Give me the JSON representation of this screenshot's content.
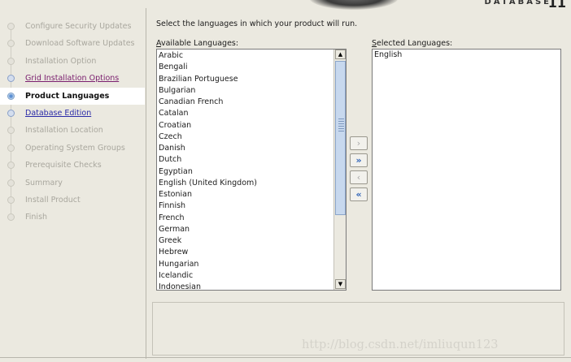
{
  "header": {
    "logo_text": "DATABASE",
    "logo_mark": "11"
  },
  "sidebar": {
    "steps": [
      {
        "label": "Configure Security Updates",
        "state": "disabled"
      },
      {
        "label": "Download Software Updates",
        "state": "disabled"
      },
      {
        "label": "Installation Option",
        "state": "disabled"
      },
      {
        "label": "Grid Installation Options",
        "state": "visited"
      },
      {
        "label": "Product Languages",
        "state": "current"
      },
      {
        "label": "Database Edition",
        "state": "link"
      },
      {
        "label": "Installation Location",
        "state": "disabled"
      },
      {
        "label": "Operating System Groups",
        "state": "disabled"
      },
      {
        "label": "Prerequisite Checks",
        "state": "disabled"
      },
      {
        "label": "Summary",
        "state": "disabled"
      },
      {
        "label": "Install Product",
        "state": "disabled"
      },
      {
        "label": "Finish",
        "state": "disabled"
      }
    ]
  },
  "main": {
    "instruction": "Select the languages in which your product will run.",
    "available_label_mnemonic": "A",
    "available_label_rest": "vailable Languages:",
    "selected_label_mnemonic": "S",
    "selected_label_rest": "elected Languages:",
    "available_languages": [
      "Arabic",
      "Bengali",
      "Brazilian Portuguese",
      "Bulgarian",
      "Canadian French",
      "Catalan",
      "Croatian",
      "Czech",
      "Danish",
      "Dutch",
      "Egyptian",
      "English (United Kingdom)",
      "Estonian",
      "Finnish",
      "French",
      "German",
      "Greek",
      "Hebrew",
      "Hungarian",
      "Icelandic",
      "Indonesian"
    ],
    "selected_languages": [
      "English"
    ],
    "buttons": {
      "add": "›",
      "add_all": "»",
      "remove": "‹",
      "remove_all": "«"
    }
  },
  "watermark": "http://blog.csdn.net/imliuqun123",
  "colors": {
    "background": "#ebe9e0",
    "link": "#2a2aa8",
    "visited": "#7a1e6e",
    "accent_button": "#2f63b8"
  }
}
